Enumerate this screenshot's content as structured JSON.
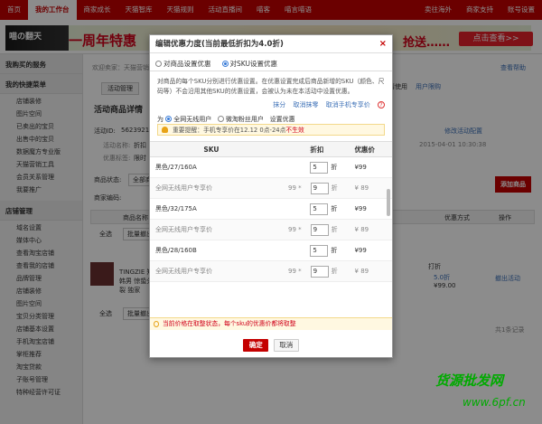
{
  "topnav": {
    "items": [
      "首页",
      "我的工作台",
      "商家成长",
      "天猫智库",
      "天猫规则",
      "活动直播间",
      "喵客",
      "喵言喵语"
    ],
    "right": [
      "卖往海外",
      "商家支持",
      "账号设置"
    ]
  },
  "banner": {
    "logo": "喵の翻天",
    "text": "一周年特惠",
    "text2": "抢送……",
    "button": "点击查看>>"
  },
  "sidebar": {
    "sec1": "我购买的服务",
    "sec2": "我的快捷菜单",
    "items1": [
      "店铺装修",
      "图片空间",
      "已卖出的宝贝",
      "出售中的宝贝",
      "数据魔方专业版",
      "天猫营销工具",
      "会员关系管理",
      "我要推广"
    ],
    "sec3": "店铺管理",
    "items2": [
      "域名设置",
      "媒体中心",
      "查看淘宝店铺",
      "查看我的店铺",
      "品牌管理",
      "店铺装修",
      "图片空间",
      "宝贝分类管理",
      "店铺基本设置",
      "手机淘宝店铺",
      "掌柜推荐",
      "淘宝贷款",
      "子账号管理",
      "特种经营许可证"
    ]
  },
  "main": {
    "breadcrumb": "欢迎卖家：天猫营销",
    "help": "查看帮助",
    "tab1": "活动管理",
    "page_title": "活动商品详情",
    "activity_id_label": "活动ID:",
    "activity_id": "5623921",
    "name_label": "活动名称:",
    "name_val": "折扣",
    "tag_label": "优惠标签:",
    "tag_val": "限时",
    "time": "2015-04-01 10:30:38",
    "status_label": "商品状态:",
    "status_val": "全部商品",
    "code_label": "商家编码:",
    "add_btn": "添加商品",
    "edit_link": "修改活动配置",
    "mobile_link": "请使用",
    "mobile_link2": "用户限购",
    "col_name": "商品名称",
    "col_type": "优惠方式",
    "col_op": "操作",
    "select_all": "全选",
    "batch": "批量撤出",
    "product_title": "TINGZIE 知韩男 惊蛰分裂 独家",
    "discount": "打折",
    "discount_val": "5.0折",
    "price": "¥99.00",
    "exit_link": "撤出活动",
    "total": "共1条记录"
  },
  "modal": {
    "title": "编辑优惠力度(当前最低折扣为4.0折)",
    "tab_product": "对商品设置优惠",
    "tab_sku": "对SKU设置优惠",
    "desc": "对商品的每个SKU分别进行优惠设置。在优惠设置完成后商品新增的SKU（颜色、尺码等）不会沿用其他SKU的优惠设置，会被认为未在本活动中设置优惠。",
    "link_wipe": "抹分",
    "link_cancel_wipe": "取消抹零",
    "link_cancel_mobile": "取消手机专享价",
    "for_label": "为",
    "opt_all": "全网无线用户",
    "opt_fans": "微淘粉丝用户",
    "opt_set": "设置优惠",
    "notice": "重要提醒：手机专享价在12.12 0点-24点",
    "notice_red": "不生效",
    "col_sku": "SKU",
    "col_discount": "折扣",
    "col_price": "优惠价",
    "zhe": "折",
    "rows": [
      {
        "sku": "黑色/27/160A",
        "disc": "5",
        "price": "¥99"
      },
      {
        "sku": "全网无线用户专享价",
        "orig": "99 *",
        "disc": "9",
        "price": "¥ 89",
        "sub": true
      },
      {
        "sku": "黑色/32/175A",
        "disc": "5",
        "price": "¥99"
      },
      {
        "sku": "全网无线用户专享价",
        "orig": "99 *",
        "disc": "9",
        "price": "¥ 89",
        "sub": true
      },
      {
        "sku": "黑色/28/160B",
        "disc": "5",
        "price": "¥99"
      },
      {
        "sku": "全网无线用户专享价",
        "orig": "99 *",
        "disc": "9",
        "price": "¥ 89",
        "sub": true
      }
    ],
    "warning": "当前价格在取整状态，每个sku的优惠价都将取整",
    "ok": "确定",
    "cancel": "取消"
  },
  "watermark": {
    "line1": "货源批发网",
    "line2": "www.6pf.cn"
  }
}
